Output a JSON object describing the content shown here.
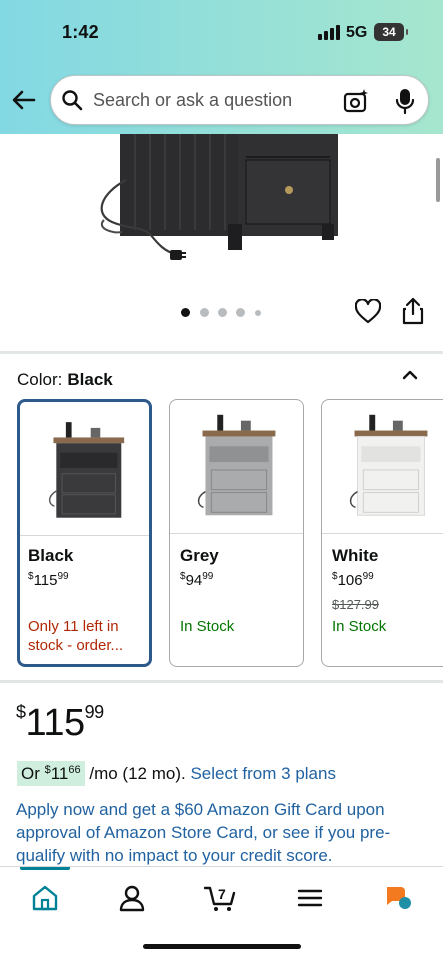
{
  "status_bar": {
    "time": "1:42",
    "network": "5G",
    "battery": "34"
  },
  "header": {
    "back_icon": "arrow-left-icon",
    "search_placeholder": "Search or ask a question",
    "camera_icon": "camera-sparkle-icon",
    "mic_icon": "microphone-icon"
  },
  "gallery": {
    "image_count": 5,
    "active_index": 0,
    "wishlist_icon": "heart-icon",
    "share_icon": "share-icon"
  },
  "color": {
    "label": "Color:",
    "selected": "Black",
    "collapse_icon": "chevron-up-icon",
    "options": [
      {
        "name": "Black",
        "price_whole": "115",
        "price_cents": "99",
        "currency": "$",
        "list_price": "",
        "stock": "Only 11 left in stock - order...",
        "stock_status": "low",
        "body_color": "#3a3a3c"
      },
      {
        "name": "Grey",
        "price_whole": "94",
        "price_cents": "99",
        "currency": "$",
        "list_price": "",
        "stock": "In Stock",
        "stock_status": "in",
        "body_color": "#a9abad"
      },
      {
        "name": "White",
        "price_whole": "106",
        "price_cents": "99",
        "currency": "$",
        "list_price": "$127.99",
        "stock": "In Stock",
        "stock_status": "in",
        "body_color": "#f1f1ef"
      }
    ]
  },
  "price": {
    "currency": "$",
    "whole": "115",
    "cents": "99"
  },
  "monthly": {
    "prefix": "Or ",
    "currency": "$",
    "whole": "11",
    "cents": "66",
    "suffix": " /mo (12 mo). ",
    "link": "Select from 3 plans"
  },
  "promo": "Apply now and get a $60 Amazon Gift Card upon approval of Amazon Store Card, or see if you pre-qualify with no impact to your credit score.",
  "bottom_nav": {
    "items": [
      {
        "name": "home-icon",
        "active": true
      },
      {
        "name": "account-icon",
        "active": false
      },
      {
        "name": "cart-icon",
        "active": false,
        "count": "7"
      },
      {
        "name": "menu-icon",
        "active": false
      },
      {
        "name": "rufus-icon",
        "active": false
      }
    ]
  },
  "colors": {
    "accent": "#008296",
    "link": "#2162a1",
    "stock_green": "#007600",
    "stock_red": "#b12704",
    "selected_border": "#2d5a8a"
  }
}
